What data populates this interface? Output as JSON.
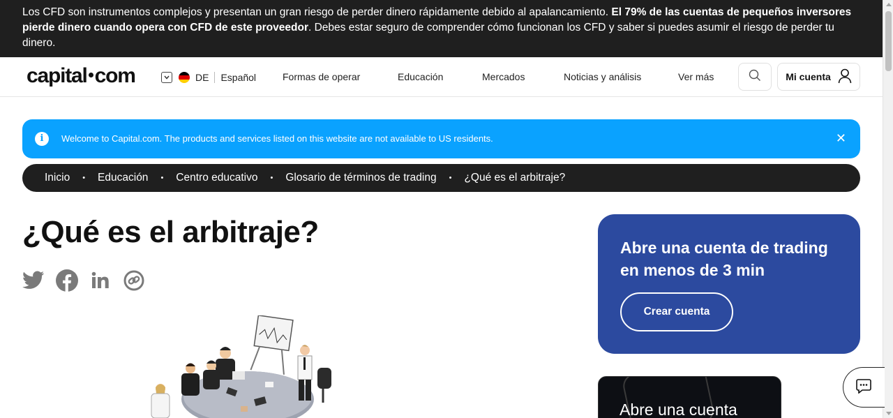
{
  "risk_banner": {
    "text_before": "Los CFD son instrumentos complejos y presentan un gran riesgo de perder dinero rápidamente debido al apalancamiento. ",
    "text_bold": "El 79% de las cuentas de pequeños inversores pierde dinero cuando opera con CFD de este proveedor",
    "text_after": ". Debes estar seguro de comprender cómo funcionan los CFD y saber si puedes asumir el riesgo de perder tu dinero."
  },
  "header": {
    "logo_left": "capital",
    "logo_right": "com",
    "country_code": "DE",
    "language": "Español",
    "nav": [
      "Formas de operar",
      "Educación",
      "Mercados",
      "Noticias y análisis",
      "Ver más"
    ],
    "account_label": "Mi cuenta",
    "icons": {
      "search": "search-icon",
      "account": "user-icon",
      "language": "chevron-down-icon",
      "flag": "germany-flag-icon"
    }
  },
  "alert": {
    "message": "Welcome to Capital.com. The products and services listed on this website are not available to US residents.",
    "close_glyph": "✕",
    "info_glyph": "i"
  },
  "breadcrumb": [
    "Inicio",
    "Educación",
    "Centro educativo",
    "Glosario de términos de trading",
    "¿Qué es el arbitraje?"
  ],
  "breadcrumb_separator": "•",
  "page": {
    "title": "¿Qué es el arbitraje?",
    "share_icons": [
      "twitter-icon",
      "facebook-icon",
      "linkedin-icon",
      "copy-link-icon"
    ]
  },
  "cta_card": {
    "heading": "Abre una cuenta de trading en menos de 3 min",
    "button": "Crear cuenta",
    "background": "#2c4a9f"
  },
  "promo_card": {
    "text": "Abre una cuenta"
  },
  "colors": {
    "alert_blue": "#0aa2ff",
    "cta_blue": "#2c4a9f",
    "dark": "#1f1f1f"
  }
}
